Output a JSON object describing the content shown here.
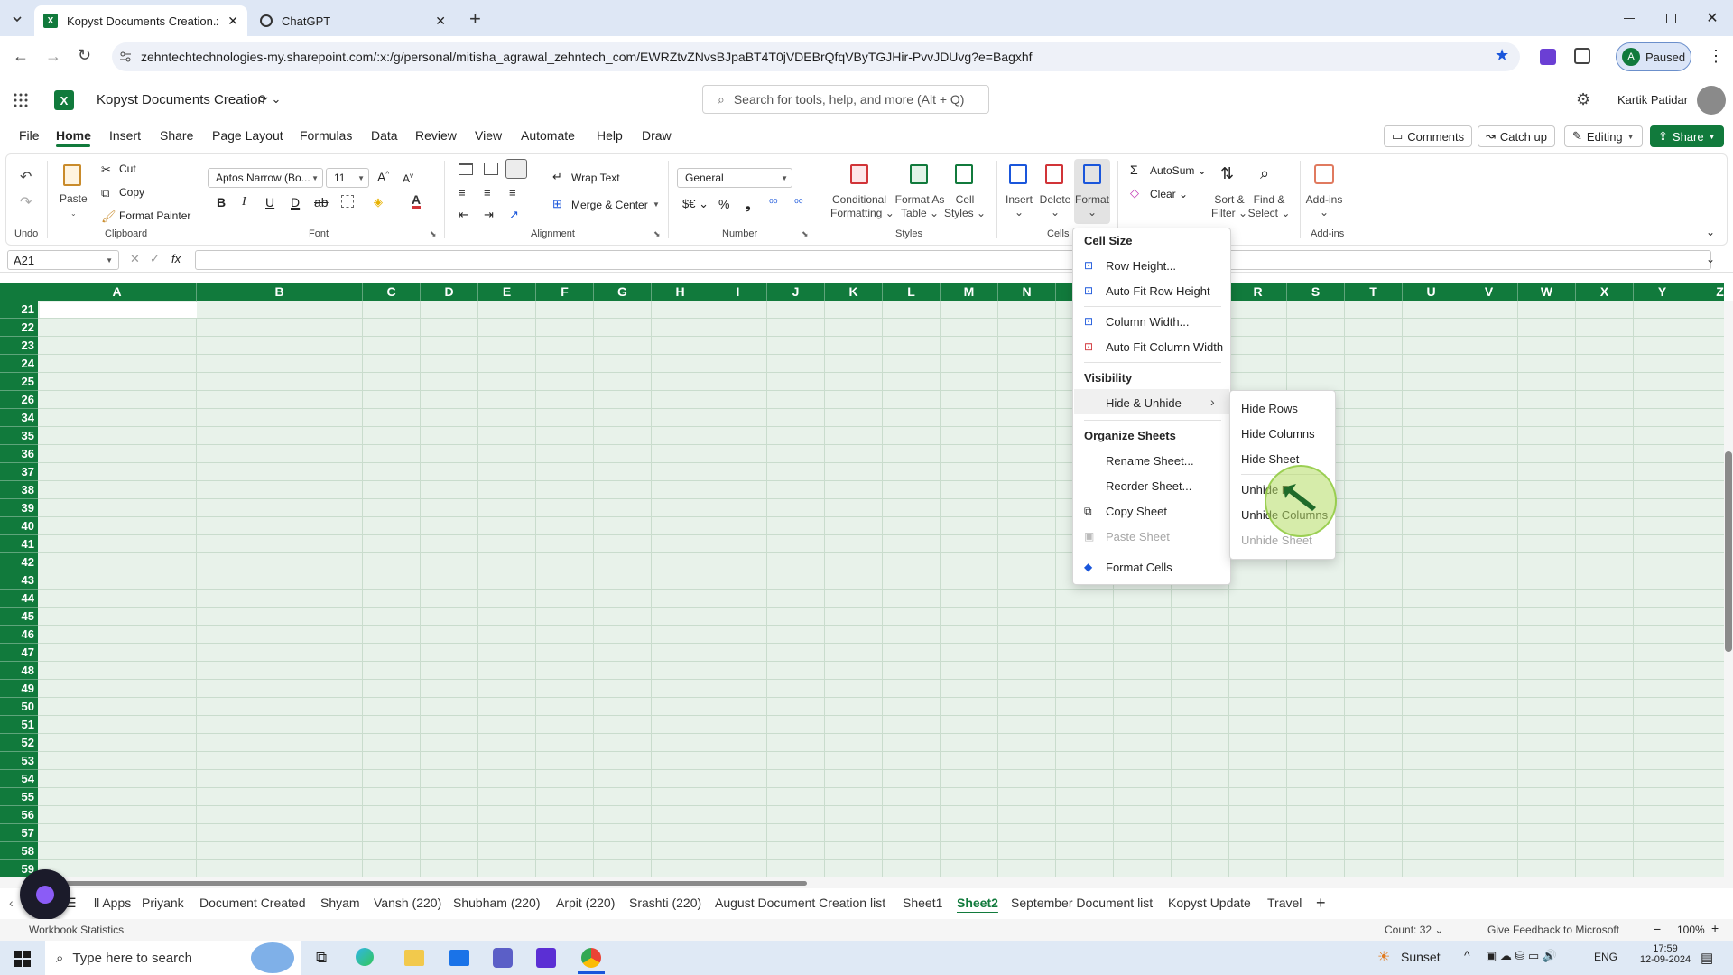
{
  "browser": {
    "tabs": [
      {
        "title": "Kopyst Documents Creation.xls",
        "active": true
      },
      {
        "title": "ChatGPT",
        "active": false
      }
    ],
    "url": "zehntechtechnologies-my.sharepoint.com/:x:/g/personal/mitisha_agrawal_zehntech_com/EWRZtvZNvsBJpaBT4T0jVDEBrQfqVByTGJHir-PvvJDUvg?e=Bagxhf",
    "profile_label": "Paused",
    "profile_initial": "A"
  },
  "excel": {
    "doc_title": "Kopyst Documents Creation",
    "search_placeholder": "Search for tools, help, and more (Alt + Q)",
    "user_name": "Kartik Patidar",
    "menu_tabs": [
      "File",
      "Home",
      "Insert",
      "Share",
      "Page Layout",
      "Formulas",
      "Data",
      "Review",
      "View",
      "Automate",
      "Help",
      "Draw"
    ],
    "active_menu_tab": "Home",
    "comments_label": "Comments",
    "catchup_label": "Catch up",
    "editing_label": "Editing",
    "share_label": "Share"
  },
  "ribbon": {
    "undo_group": "Undo",
    "paste": "Paste",
    "cut": "Cut",
    "copy": "Copy",
    "format_painter": "Format Painter",
    "clipboard_group": "Clipboard",
    "font_name": "Aptos Narrow (Bo...",
    "font_size": "11",
    "font_group": "Font",
    "wrap_text": "Wrap Text",
    "merge_center": "Merge & Center",
    "alignment_group": "Alignment",
    "number_format": "General",
    "number_group": "Number",
    "conditional_formatting": [
      "Conditional",
      "Formatting"
    ],
    "format_as_table": [
      "Format As",
      "Table"
    ],
    "cell_styles": [
      "Cell",
      "Styles"
    ],
    "styles_group": "Styles",
    "insert": "Insert",
    "delete": "Delete",
    "format": "Format",
    "cells_group": "Cells",
    "autosum": "AutoSum",
    "clear": "Clear",
    "sort_filter": [
      "Sort &",
      "Filter"
    ],
    "find_select": [
      "Find &",
      "Select"
    ],
    "addins": "Add-ins",
    "addins_group": "Add-ins"
  },
  "formula_bar": {
    "name_box": "A21",
    "fx": "fx"
  },
  "grid": {
    "columns": [
      "A",
      "B",
      "C",
      "D",
      "E",
      "F",
      "G",
      "H",
      "I",
      "J",
      "K",
      "L",
      "M",
      "N",
      "",
      "",
      "",
      "R",
      "S",
      "T",
      "U",
      "V",
      "W",
      "X",
      "Y",
      "Z"
    ],
    "rows": [
      "21",
      "22",
      "23",
      "24",
      "25",
      "26",
      "34",
      "35",
      "36",
      "37",
      "38",
      "39",
      "40",
      "41",
      "42",
      "43",
      "44",
      "45",
      "46",
      "47",
      "48",
      "49",
      "50",
      "51",
      "52",
      "53",
      "54",
      "55",
      "56",
      "57",
      "58",
      "59"
    ]
  },
  "format_menu": {
    "cell_size_header": "Cell Size",
    "row_height": "Row Height...",
    "autofit_row": "Auto Fit Row Height",
    "column_width": "Column Width...",
    "autofit_column": "Auto Fit Column Width",
    "visibility_header": "Visibility",
    "hide_unhide": "Hide & Unhide",
    "organize_header": "Organize Sheets",
    "rename_sheet": "Rename Sheet...",
    "reorder_sheet": "Reorder Sheet...",
    "copy_sheet": "Copy Sheet",
    "paste_sheet": "Paste Sheet",
    "format_cells": "Format Cells"
  },
  "submenu": {
    "hide_rows": "Hide Rows",
    "hide_columns": "Hide Columns",
    "hide_sheet": "Hide Sheet",
    "unhide_rows": "Unhide R",
    "unhide_columns": "Unhide Columns",
    "unhide_sheet": "Unhide Sheet"
  },
  "sheets": {
    "tabs": [
      "ll Apps",
      "Priyank",
      "Document Created",
      "Shyam",
      "Vansh (220)",
      "Shubham (220)",
      "Arpit (220)",
      "Srashti (220)",
      "August Document Creation list",
      "Sheet1",
      "Sheet2",
      "September Document list",
      "Kopyst Update",
      "Travel"
    ],
    "active": "Sheet2"
  },
  "status": {
    "workbook_stats": "Workbook Statistics",
    "count": "Count: 32",
    "feedback": "Give Feedback to Microsoft",
    "zoom": "100%"
  },
  "taskbar": {
    "search_placeholder": "Type here to search",
    "weather": "Sunset",
    "lang": "ENG",
    "time": "17:59",
    "date": "12-09-2024"
  },
  "colors": {
    "accent": "#117a3c",
    "grid_bg": "#e8f2ea"
  }
}
